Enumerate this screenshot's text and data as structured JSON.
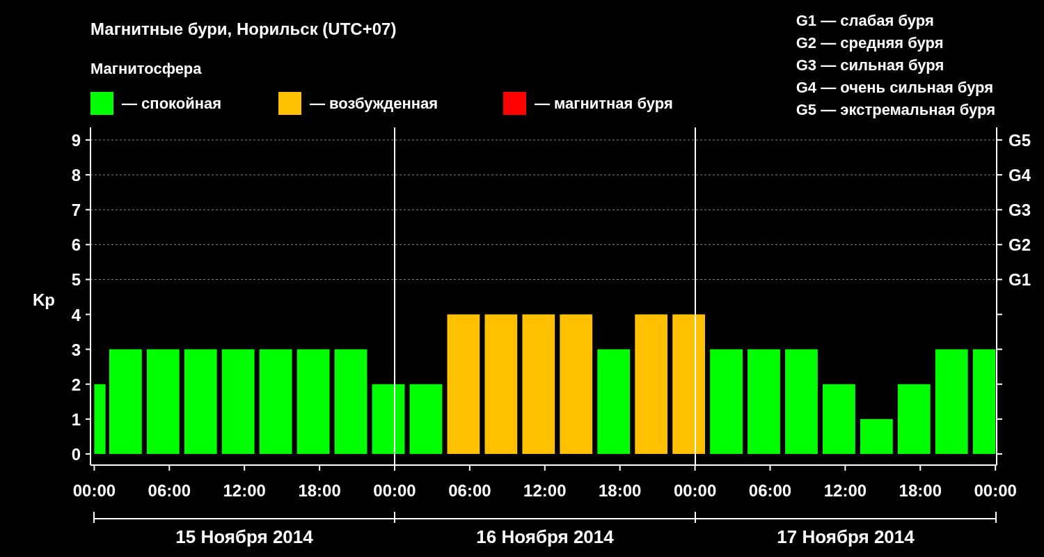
{
  "title": "Магнитные бури, Норильск (UTC+07)",
  "legend": {
    "title": "Магнитосфера",
    "items": [
      {
        "label": "— спокойная",
        "color": "#00ff00"
      },
      {
        "label": "— возбужденная",
        "color": "#ffc000"
      },
      {
        "label": "— магнитная буря",
        "color": "#ff0000"
      }
    ]
  },
  "storm_scale": [
    "G1 — слабая буря",
    "G2 — средняя буря",
    "G3 — сильная буря",
    "G4 — очень сильная буря",
    "G5 — экстремальная буря"
  ],
  "chart_data": {
    "type": "bar",
    "ylabel": "Kp",
    "grid": true,
    "xlim": [
      "2014-11-14T23:42",
      "2014-11-18T00:06"
    ],
    "ylim": [
      -0.32,
      9.36
    ],
    "x": [
      "2014-11-15T00:27",
      "2014-11-15T02:30",
      "2014-11-15T05:30",
      "2014-11-15T08:30",
      "2014-11-15T11:30",
      "2014-11-15T14:30",
      "2014-11-15T17:30",
      "2014-11-15T20:30",
      "2014-11-15T23:30",
      "2014-11-16T02:30",
      "2014-11-16T05:30",
      "2014-11-16T08:30",
      "2014-11-16T11:30",
      "2014-11-16T14:30",
      "2014-11-16T17:30",
      "2014-11-16T20:30",
      "2014-11-16T23:30",
      "2014-11-17T02:30",
      "2014-11-17T05:30",
      "2014-11-17T08:30",
      "2014-11-17T11:30",
      "2014-11-17T14:30",
      "2014-11-17T17:30",
      "2014-11-17T20:30",
      "2014-11-17T23:06"
    ],
    "series": [
      {
        "color": "#00ff00",
        "values": [
          2,
          3,
          3,
          3,
          3,
          3,
          3,
          3,
          2,
          2,
          null,
          null,
          null,
          null,
          3,
          null,
          null,
          3,
          3,
          3,
          2,
          1,
          2,
          3,
          3
        ]
      },
      {
        "color": "#ffc000",
        "values": [
          null,
          null,
          null,
          null,
          null,
          null,
          null,
          null,
          null,
          null,
          4,
          4,
          4,
          4,
          null,
          4,
          4,
          null,
          null,
          null,
          null,
          null,
          null,
          null,
          null
        ]
      }
    ],
    "yticks": [
      0,
      1,
      2,
      3,
      4,
      5,
      6,
      7,
      8,
      9
    ],
    "xticks": [
      {
        "value": "2014-11-15T00:00",
        "label": "00:00"
      },
      {
        "value": "2014-11-15T06:00",
        "label": "06:00"
      },
      {
        "value": "2014-11-15T12:00",
        "label": "12:00"
      },
      {
        "value": "2014-11-15T18:00",
        "label": "18:00"
      },
      {
        "value": "2014-11-16T00:00",
        "label": "00:00"
      },
      {
        "value": "2014-11-16T06:00",
        "label": "06:00"
      },
      {
        "value": "2014-11-16T12:00",
        "label": "12:00"
      },
      {
        "value": "2014-11-16T18:00",
        "label": "18:00"
      },
      {
        "value": "2014-11-17T00:00",
        "label": "00:00"
      },
      {
        "value": "2014-11-17T06:00",
        "label": "06:00"
      },
      {
        "value": "2014-11-17T12:00",
        "label": "12:00"
      },
      {
        "value": "2014-11-17T18:00",
        "label": "18:00"
      },
      {
        "value": "2014-11-18T00:00",
        "label": "00:00"
      }
    ]
  },
  "storm_levels": [
    "G5",
    "G4",
    "G3",
    "G2",
    "G1"
  ],
  "dates": [
    "15 Ноября 2014",
    "16 Ноября 2014",
    "17 Ноября 2014"
  ]
}
